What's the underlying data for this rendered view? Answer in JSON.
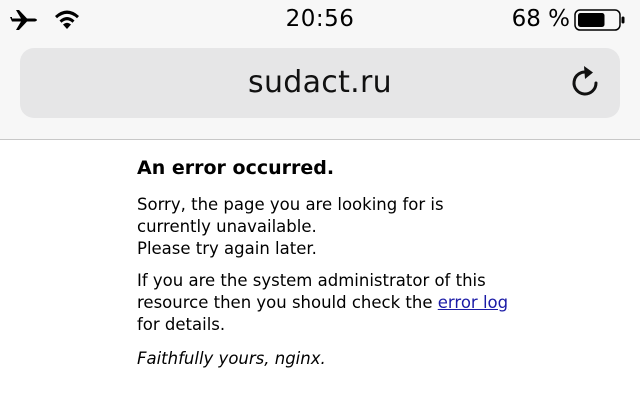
{
  "status_bar": {
    "time": "20:56",
    "battery_percent": "68 %",
    "battery_level": 0.68,
    "icons": [
      "airplane-icon",
      "wifi-icon",
      "battery-icon"
    ]
  },
  "browser": {
    "url": "sudact.ru",
    "reload_icon": "reload-icon"
  },
  "page": {
    "title": "An error occurred.",
    "line1": "Sorry, the page you are looking for is currently unavailable.",
    "line2": "Please try again later.",
    "admin_text": "If you are the system administrator of this resource then you should check the",
    "link_text": "error log",
    "admin_suffix": "for details.",
    "signature": "Faithfully yours, nginx."
  },
  "colors": {
    "link": "#1a1aa6",
    "url_field_bg": "#e6e6e7",
    "chrome_bg": "#f7f7f7"
  }
}
